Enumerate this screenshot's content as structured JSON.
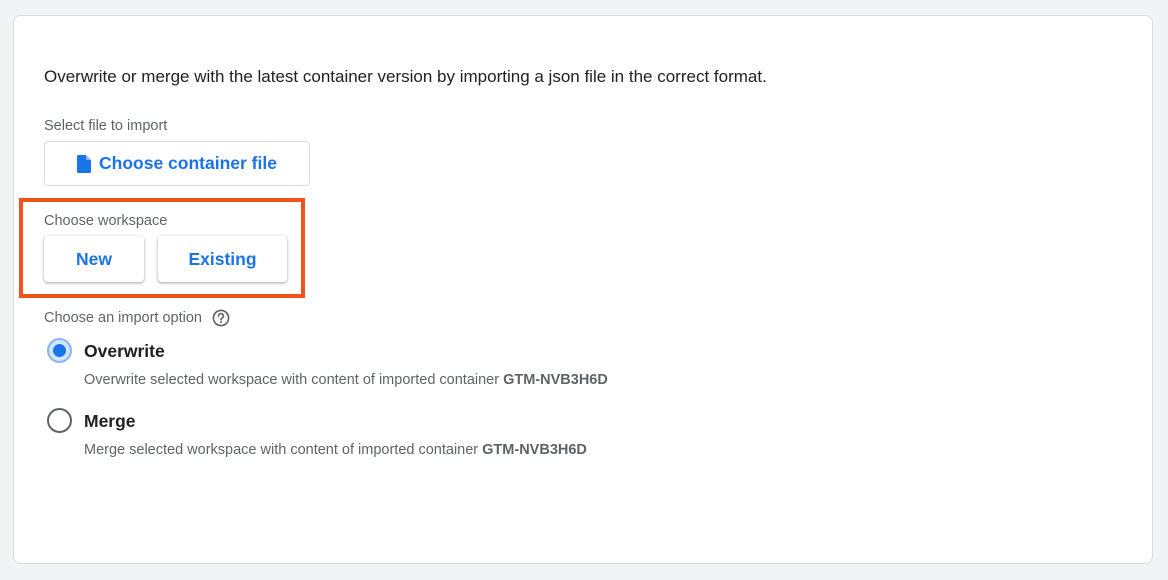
{
  "intro": "Overwrite or merge with the latest container version by importing a json file in the correct format.",
  "file": {
    "label": "Select file to import",
    "button_label": "Choose container file",
    "icon": "file-icon"
  },
  "workspace": {
    "label": "Choose workspace",
    "options": [
      "New",
      "Existing"
    ],
    "highlight_color": "#f4511e"
  },
  "import_option": {
    "label": "Choose an import option",
    "help_icon": "help-circle-icon",
    "selected": "Overwrite",
    "options": [
      {
        "title": "Overwrite",
        "description": "Overwrite selected workspace with content of imported container",
        "container_id": "GTM-NVB3H6D"
      },
      {
        "title": "Merge",
        "description": "Merge selected workspace with content of imported container",
        "container_id": "GTM-NVB3H6D"
      }
    ]
  },
  "colors": {
    "accent": "#1a73e8",
    "text": "#202124",
    "secondary_text": "#5f6368"
  }
}
